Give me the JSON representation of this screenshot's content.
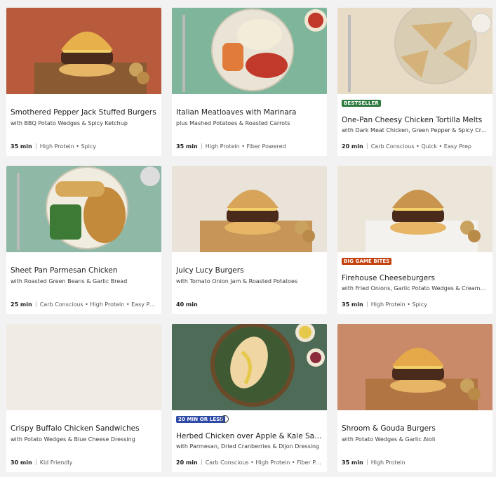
{
  "recipes": [
    {
      "title": "Smothered Pepper Jack Stuffed Burgers",
      "subtitle": "with BBQ Potato Wedges & Spicy Ketchup",
      "time": "35 min",
      "tags": "High Protein • Spicy",
      "badge": "",
      "image": "burger-with-potato-wedges-photo",
      "colors": {
        "bg": "#b85a3c",
        "board": "#8a5a32",
        "accent": "#e8b04a"
      }
    },
    {
      "title": "Italian Meatloaves with Marinara",
      "subtitle": "plus Mashed Potatoes & Roasted Carrots",
      "time": "35 min",
      "tags": "High Protein • Fiber Powered",
      "badge": "",
      "image": "meatloaf-plate-photo",
      "colors": {
        "bg": "#7fb59a",
        "board": "#eae4d6",
        "accent": "#c0392b"
      }
    },
    {
      "title": "One-Pan Cheesy Chicken Tortilla Melts",
      "subtitle": "with Dark Meat Chicken, Green Pepper & Spicy Crema",
      "time": "20 min",
      "tags": "Carb Conscious • Quick • Easy Prep",
      "badge": "BESTSELLER",
      "badge_class": "bestseller",
      "image": "tortilla-melts-plate-photo",
      "colors": {
        "bg": "#e9dcc6",
        "board": "#d9cdb4",
        "accent": "#d4b27a"
      }
    },
    {
      "title": "Sheet Pan Parmesan Chicken",
      "subtitle": "with Roasted Green Beans & Garlic Bread",
      "time": "25 min",
      "tags": "Carb Conscious • High Protein • Easy Prep",
      "badge": "",
      "image": "parmesan-chicken-plate-photo",
      "colors": {
        "bg": "#8fb9a6",
        "board": "#f1ece0",
        "accent": "#c48a3c"
      }
    },
    {
      "title": "Juicy Lucy Burgers",
      "subtitle": "with Tomato Onion Jam & Roasted Potatoes",
      "time": "40 min",
      "tags": "",
      "badge": "",
      "image": "juicy-lucy-burger-photo",
      "colors": {
        "bg": "#e9e3da",
        "board": "#c79558",
        "accent": "#d8a45a"
      }
    },
    {
      "title": "Firehouse Cheeseburgers",
      "subtitle": "with Fried Onions, Garlic Potato Wedges & Creamy Sriracha",
      "time": "35 min",
      "tags": "High Protein • Spicy",
      "badge": "BIG GAME BITES",
      "badge_class": "biggame",
      "image": "firehouse-cheeseburger-photo",
      "colors": {
        "bg": "#ece5da",
        "board": "#f4f2ee",
        "accent": "#c9944e"
      }
    },
    {
      "title": "Crispy Buffalo Chicken Sandwiches",
      "subtitle": "with Potato Wedges & Blue Cheese Dressing",
      "time": "30 min",
      "tags": "Kid Friendly",
      "badge": "",
      "image": "buffalo-chicken-sandwich-photo",
      "colors": {
        "bg": "#f0ebe3",
        "board": "#b88752",
        "accent": "#d49a4c"
      }
    },
    {
      "title": "Herbed Chicken over Apple & Kale Salad",
      "subtitle": "with Parmesan, Dried Cranberries & Dijon Dressing",
      "time": "20 min",
      "tags": "Carb Conscious • High Protein • Fiber Powered",
      "badge": "20 MIN OR LESS",
      "badge_class": "twentymin",
      "info_icon": "info-icon",
      "image": "chicken-kale-salad-photo",
      "colors": {
        "bg": "#4d6b57",
        "board": "#3f5a33",
        "accent": "#e6c84a"
      }
    },
    {
      "title": "Shroom & Gouda Burgers",
      "subtitle": "with Potato Wedges & Garlic Aioli",
      "time": "35 min",
      "tags": "High Protein",
      "badge": "",
      "image": "mushroom-gouda-burger-photo",
      "colors": {
        "bg": "#c98a6a",
        "board": "#b07542",
        "accent": "#e6a94a"
      }
    }
  ]
}
